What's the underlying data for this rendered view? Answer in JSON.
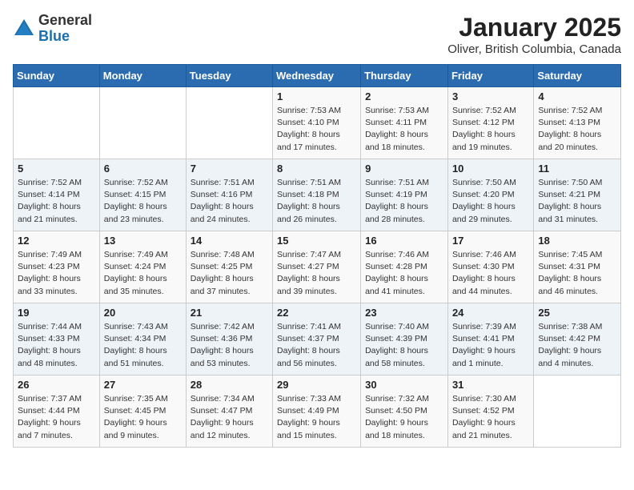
{
  "header": {
    "logo_general": "General",
    "logo_blue": "Blue",
    "month_title": "January 2025",
    "location": "Oliver, British Columbia, Canada"
  },
  "days_of_week": [
    "Sunday",
    "Monday",
    "Tuesday",
    "Wednesday",
    "Thursday",
    "Friday",
    "Saturday"
  ],
  "weeks": [
    [
      {
        "day": "",
        "info": ""
      },
      {
        "day": "",
        "info": ""
      },
      {
        "day": "",
        "info": ""
      },
      {
        "day": "1",
        "info": "Sunrise: 7:53 AM\nSunset: 4:10 PM\nDaylight: 8 hours\nand 17 minutes."
      },
      {
        "day": "2",
        "info": "Sunrise: 7:53 AM\nSunset: 4:11 PM\nDaylight: 8 hours\nand 18 minutes."
      },
      {
        "day": "3",
        "info": "Sunrise: 7:52 AM\nSunset: 4:12 PM\nDaylight: 8 hours\nand 19 minutes."
      },
      {
        "day": "4",
        "info": "Sunrise: 7:52 AM\nSunset: 4:13 PM\nDaylight: 8 hours\nand 20 minutes."
      }
    ],
    [
      {
        "day": "5",
        "info": "Sunrise: 7:52 AM\nSunset: 4:14 PM\nDaylight: 8 hours\nand 21 minutes."
      },
      {
        "day": "6",
        "info": "Sunrise: 7:52 AM\nSunset: 4:15 PM\nDaylight: 8 hours\nand 23 minutes."
      },
      {
        "day": "7",
        "info": "Sunrise: 7:51 AM\nSunset: 4:16 PM\nDaylight: 8 hours\nand 24 minutes."
      },
      {
        "day": "8",
        "info": "Sunrise: 7:51 AM\nSunset: 4:18 PM\nDaylight: 8 hours\nand 26 minutes."
      },
      {
        "day": "9",
        "info": "Sunrise: 7:51 AM\nSunset: 4:19 PM\nDaylight: 8 hours\nand 28 minutes."
      },
      {
        "day": "10",
        "info": "Sunrise: 7:50 AM\nSunset: 4:20 PM\nDaylight: 8 hours\nand 29 minutes."
      },
      {
        "day": "11",
        "info": "Sunrise: 7:50 AM\nSunset: 4:21 PM\nDaylight: 8 hours\nand 31 minutes."
      }
    ],
    [
      {
        "day": "12",
        "info": "Sunrise: 7:49 AM\nSunset: 4:23 PM\nDaylight: 8 hours\nand 33 minutes."
      },
      {
        "day": "13",
        "info": "Sunrise: 7:49 AM\nSunset: 4:24 PM\nDaylight: 8 hours\nand 35 minutes."
      },
      {
        "day": "14",
        "info": "Sunrise: 7:48 AM\nSunset: 4:25 PM\nDaylight: 8 hours\nand 37 minutes."
      },
      {
        "day": "15",
        "info": "Sunrise: 7:47 AM\nSunset: 4:27 PM\nDaylight: 8 hours\nand 39 minutes."
      },
      {
        "day": "16",
        "info": "Sunrise: 7:46 AM\nSunset: 4:28 PM\nDaylight: 8 hours\nand 41 minutes."
      },
      {
        "day": "17",
        "info": "Sunrise: 7:46 AM\nSunset: 4:30 PM\nDaylight: 8 hours\nand 44 minutes."
      },
      {
        "day": "18",
        "info": "Sunrise: 7:45 AM\nSunset: 4:31 PM\nDaylight: 8 hours\nand 46 minutes."
      }
    ],
    [
      {
        "day": "19",
        "info": "Sunrise: 7:44 AM\nSunset: 4:33 PM\nDaylight: 8 hours\nand 48 minutes."
      },
      {
        "day": "20",
        "info": "Sunrise: 7:43 AM\nSunset: 4:34 PM\nDaylight: 8 hours\nand 51 minutes."
      },
      {
        "day": "21",
        "info": "Sunrise: 7:42 AM\nSunset: 4:36 PM\nDaylight: 8 hours\nand 53 minutes."
      },
      {
        "day": "22",
        "info": "Sunrise: 7:41 AM\nSunset: 4:37 PM\nDaylight: 8 hours\nand 56 minutes."
      },
      {
        "day": "23",
        "info": "Sunrise: 7:40 AM\nSunset: 4:39 PM\nDaylight: 8 hours\nand 58 minutes."
      },
      {
        "day": "24",
        "info": "Sunrise: 7:39 AM\nSunset: 4:41 PM\nDaylight: 9 hours\nand 1 minute."
      },
      {
        "day": "25",
        "info": "Sunrise: 7:38 AM\nSunset: 4:42 PM\nDaylight: 9 hours\nand 4 minutes."
      }
    ],
    [
      {
        "day": "26",
        "info": "Sunrise: 7:37 AM\nSunset: 4:44 PM\nDaylight: 9 hours\nand 7 minutes."
      },
      {
        "day": "27",
        "info": "Sunrise: 7:35 AM\nSunset: 4:45 PM\nDaylight: 9 hours\nand 9 minutes."
      },
      {
        "day": "28",
        "info": "Sunrise: 7:34 AM\nSunset: 4:47 PM\nDaylight: 9 hours\nand 12 minutes."
      },
      {
        "day": "29",
        "info": "Sunrise: 7:33 AM\nSunset: 4:49 PM\nDaylight: 9 hours\nand 15 minutes."
      },
      {
        "day": "30",
        "info": "Sunrise: 7:32 AM\nSunset: 4:50 PM\nDaylight: 9 hours\nand 18 minutes."
      },
      {
        "day": "31",
        "info": "Sunrise: 7:30 AM\nSunset: 4:52 PM\nDaylight: 9 hours\nand 21 minutes."
      },
      {
        "day": "",
        "info": ""
      }
    ]
  ]
}
